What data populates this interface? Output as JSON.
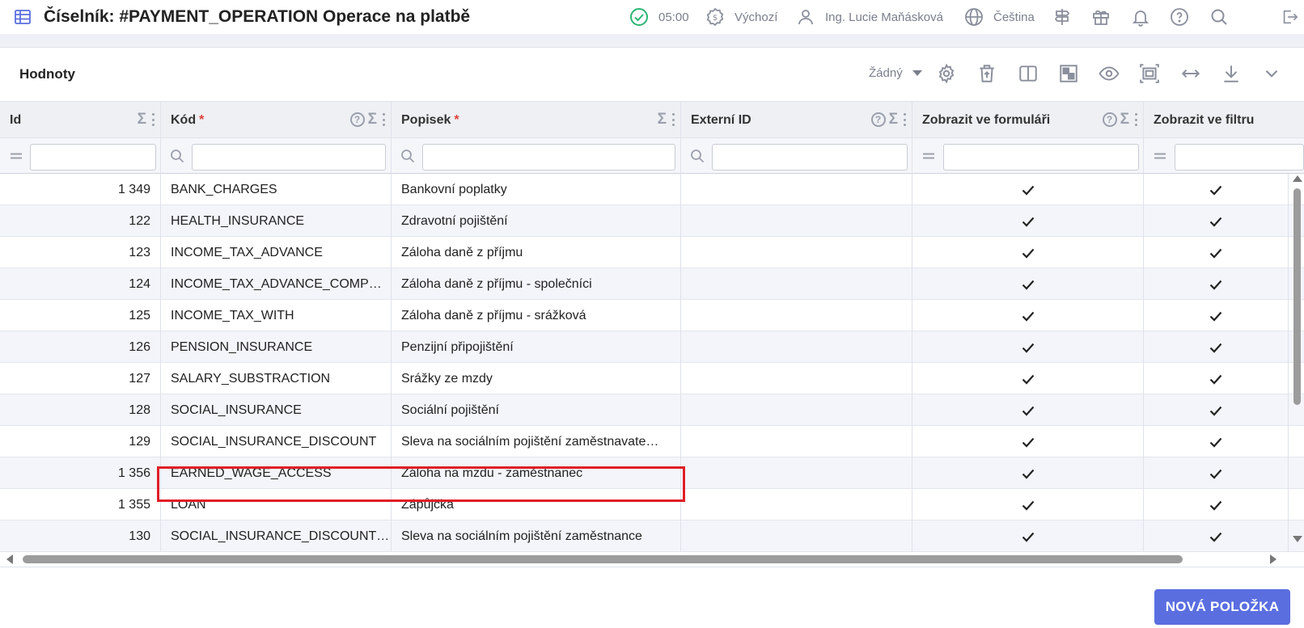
{
  "header": {
    "title": "Číselník: #PAYMENT_OPERATION Operace na platbě",
    "timer": "05:00",
    "profile": "Výchozí",
    "user": "Ing. Lucie Maňásková",
    "language": "Čeština"
  },
  "card": {
    "title": "Hodnoty",
    "view_select": "Žádný"
  },
  "columns": [
    {
      "label": "Id",
      "required": false
    },
    {
      "label": "Kód",
      "required": true
    },
    {
      "label": "Popisek",
      "required": true
    },
    {
      "label": "Externí ID",
      "required": false
    },
    {
      "label": "Zobrazit ve formuláři",
      "required": false
    },
    {
      "label": "Zobrazit ve filtru",
      "required": false
    }
  ],
  "required_mark": "*",
  "rows": [
    {
      "id": "1 349",
      "code": "BANK_CHARGES",
      "label": "Bankovní poplatky",
      "external_id": "",
      "show_form": true,
      "show_filter": true
    },
    {
      "id": "122",
      "code": "HEALTH_INSURANCE",
      "label": "Zdravotní pojištění",
      "external_id": "",
      "show_form": true,
      "show_filter": true
    },
    {
      "id": "123",
      "code": "INCOME_TAX_ADVANCE",
      "label": "Záloha daně z příjmu",
      "external_id": "",
      "show_form": true,
      "show_filter": true
    },
    {
      "id": "124",
      "code": "INCOME_TAX_ADVANCE_COMP…",
      "label": "Záloha daně z příjmu - společníci",
      "external_id": "",
      "show_form": true,
      "show_filter": true
    },
    {
      "id": "125",
      "code": "INCOME_TAX_WITH",
      "label": "Záloha daně z příjmu - srážková",
      "external_id": "",
      "show_form": true,
      "show_filter": true
    },
    {
      "id": "126",
      "code": "PENSION_INSURANCE",
      "label": "Penzijní připojištění",
      "external_id": "",
      "show_form": true,
      "show_filter": true
    },
    {
      "id": "127",
      "code": "SALARY_SUBSTRACTION",
      "label": "Srážky ze mzdy",
      "external_id": "",
      "show_form": true,
      "show_filter": true
    },
    {
      "id": "128",
      "code": "SOCIAL_INSURANCE",
      "label": "Sociální pojištění",
      "external_id": "",
      "show_form": true,
      "show_filter": true
    },
    {
      "id": "129",
      "code": "SOCIAL_INSURANCE_DISCOUNT",
      "label": "Sleva na sociálním pojištění zaměstnavate…",
      "external_id": "",
      "show_form": true,
      "show_filter": true
    },
    {
      "id": "1 356",
      "code": "EARNED_WAGE_ACCESS",
      "label": "Záloha na mzdu - zaměstnanec",
      "external_id": "",
      "show_form": true,
      "show_filter": true
    },
    {
      "id": "1 355",
      "code": "LOAN",
      "label": "Zápůjčka",
      "external_id": "",
      "show_form": true,
      "show_filter": true
    },
    {
      "id": "130",
      "code": "SOCIAL_INSURANCE_DISCOUNT…",
      "label": "Sleva na sociálním pojištění zaměstnance",
      "external_id": "",
      "show_form": true,
      "show_filter": true
    }
  ],
  "footer": {
    "new_button": "NOVÁ POLOŽKA"
  },
  "colors": {
    "accent": "#5a6ee0",
    "highlight": "#e01e26",
    "success": "#2bb673"
  }
}
